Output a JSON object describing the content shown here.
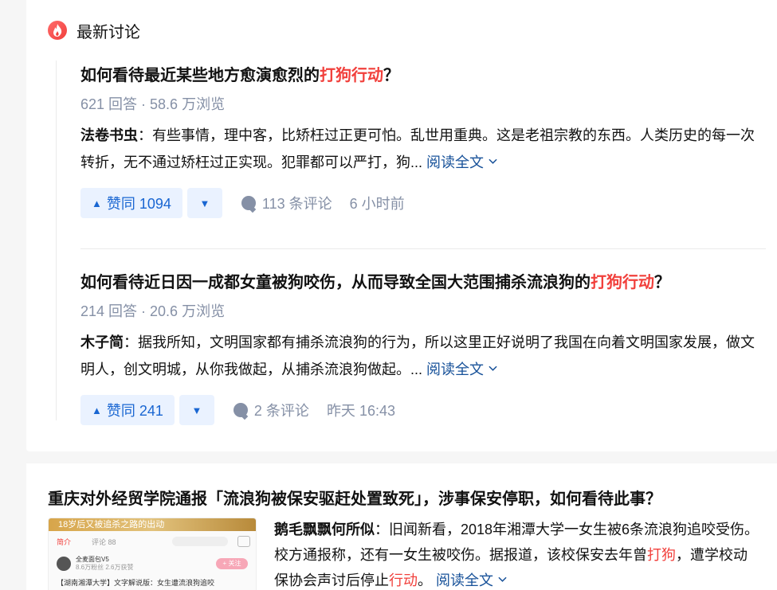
{
  "section": {
    "title": "最新讨论",
    "icon": "fire-icon"
  },
  "items": [
    {
      "title_pre": "如何看待最近某些地方愈演愈烈的",
      "title_hl": "打狗行动",
      "title_post": "？",
      "meta": "621 回答 · 58.6 万浏览",
      "author": "法卷书虫",
      "excerpt": "：有些事情，理中客，比矫枉过正更可怕。乱世用重典。这是老祖宗教的东西。人类历史的每一次转折，无不通过矫枉过正实现。犯罪都可以严打，狗...",
      "read_more": "阅读全文",
      "vote_label": "赞同 1094",
      "comments": "113 条评论",
      "time": "6 小时前"
    },
    {
      "title_pre": "如何看待近日因一成都女童被狗咬伤，从而导致全国大范围捕杀流浪狗的",
      "title_hl": "打狗行动",
      "title_post": "？",
      "meta": "214 回答 · 20.6 万浏览",
      "author": "木子简",
      "excerpt": "：据我所知，文明国家都有捕杀流浪狗的行为，所以这里正好说明了我国在向着文明国家发展，做文明人，创文明城，从你我做起，从捕杀流浪狗做起。...",
      "read_more": "阅读全文",
      "vote_label": "赞同 241",
      "comments": "2 条评论",
      "time": "昨天 16:43"
    }
  ],
  "card2": {
    "title": "重庆对外经贸学院通报「流浪狗被保安驱赶处置致死」，涉事保安停职，如何看待此事？",
    "author": "鹅毛飘飘何所似",
    "excerpt_a": "：旧闻新看，2018年湘潭大学一女生被6条流浪狗追咬受伤。校方通报称，还有一女生被咬伤。据报道，该校保安去年曾",
    "excerpt_hl1": "打狗",
    "excerpt_b": "，遭学校动保协会声讨后停止",
    "excerpt_hl2": "行动",
    "excerpt_c": "。",
    "read_more": "阅读全文",
    "thumb": {
      "banner": "18岁后又被追杀之路的出动",
      "tab1": "简介",
      "tab2": "评论 88",
      "user": "全麦面包V5",
      "user_stats": "8.6万粉丝  2.6万获赞",
      "follow": "+ 关注",
      "caption": "【湖南湘潭大学】文字解说版：女生遭流浪狗追咬"
    }
  },
  "colors": {
    "accent": "#1966d2",
    "highlight": "#f1403c",
    "meta": "#8590a6",
    "link": "#175199"
  }
}
